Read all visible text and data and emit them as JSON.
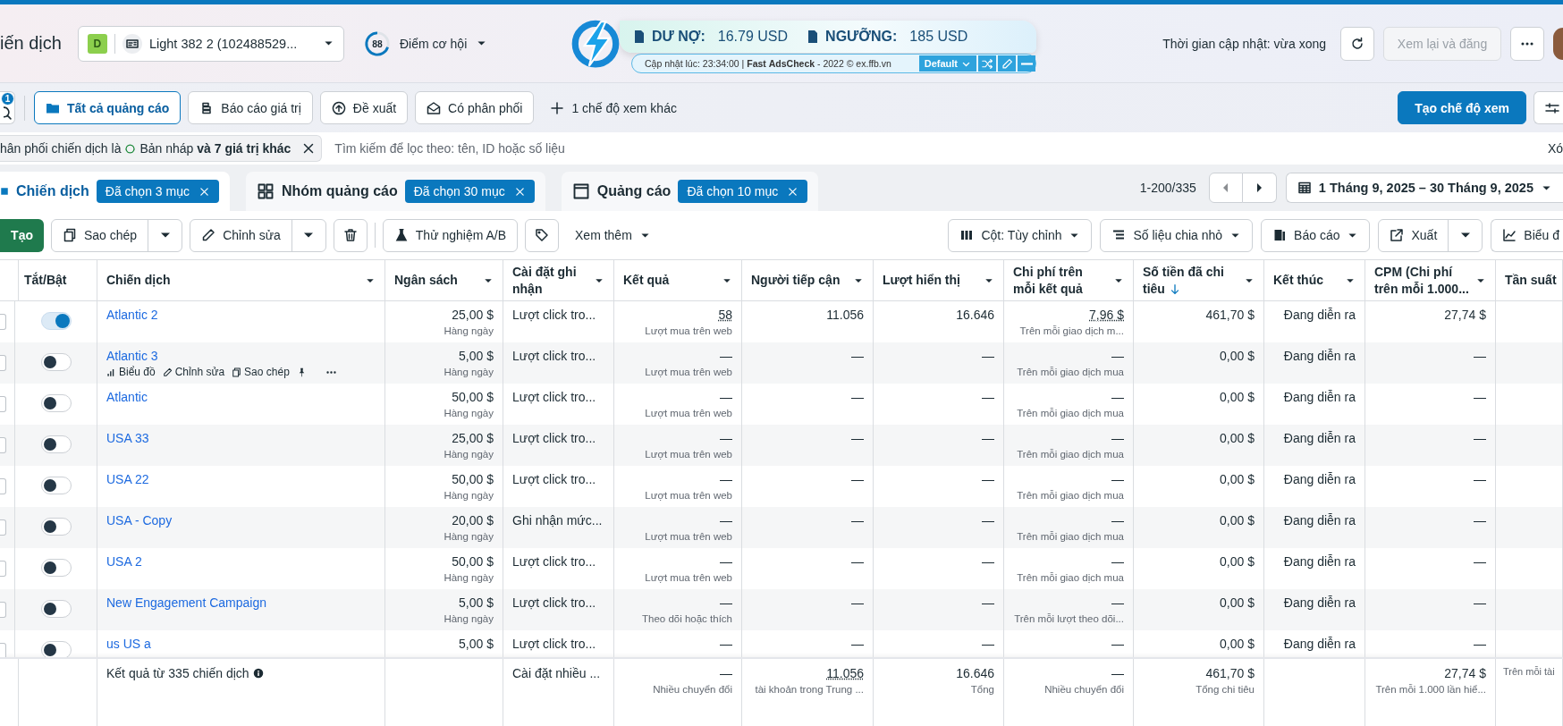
{
  "header": {
    "title": "iến dịch",
    "account": {
      "badge": "D",
      "name": "Light 382 2 (102488529..."
    },
    "score": {
      "value": "88",
      "label": "Điểm cơ hội"
    },
    "update_time": "Thời gian cập nhật: vừa xong",
    "review_button": {
      "label": "Xem lại và đăng",
      "disabled": true
    }
  },
  "extension": {
    "debt_label": "DƯ NỢ:",
    "debt_value": "16.79 USD",
    "threshold_label": "NGƯỠNG:",
    "threshold_value": "185 USD",
    "status": "Cập nhật lúc: 23:34:00 | **Fast** **AdsCheck** - 2022 © ex.ffb.vn",
    "preset": "Default"
  },
  "views": {
    "search_badge": "1",
    "items": [
      {
        "label": "Tất cả quảng cáo",
        "kind": "folder",
        "selected": true
      },
      {
        "label": "Báo cáo giá trị",
        "kind": "coins",
        "selected": false
      },
      {
        "label": "Đề xuất",
        "kind": "upload",
        "selected": false
      },
      {
        "label": "Có phân phối",
        "kind": "mail",
        "selected": false
      }
    ],
    "more": "1 chế độ xem khác",
    "create": "Tạo chế độ xem"
  },
  "filter": {
    "prefix": "hân phối chiến dịch là",
    "value": "Bản nháp **và 7 giá trị khác**",
    "search_placeholder": "Tìm kiếm để lọc theo: tên, ID hoặc số liệu",
    "clear": "Xó"
  },
  "levels": [
    {
      "label": "Chiến dịch",
      "kind": "campaign",
      "badge": "Đã chọn 3 mục",
      "selected": true
    },
    {
      "label": "Nhóm quảng cáo",
      "kind": "adset",
      "badge": "Đã chọn 30 mục",
      "selected": false
    },
    {
      "label": "Quảng cáo",
      "kind": "ad",
      "badge": "Đã chọn 10 mục",
      "selected": false
    }
  ],
  "pagination": "1-200/335",
  "date_range": "1 Tháng 9, 2025 – 30 Tháng 9, 2025",
  "toolbar": {
    "create": "Tạo",
    "duplicate": "Sao chép",
    "edit": "Chỉnh sửa",
    "ab_test": "Thử nghiệm A/B",
    "more": "Xem thêm",
    "columns": "Cột: Tùy chỉnh",
    "breakdown": "Số liệu chia nhỏ",
    "reports": "Báo cáo",
    "export": "Xuất",
    "charts": "Biểu đ"
  },
  "table": {
    "fixed_columns": [
      {
        "label": "Tắt/Bật"
      },
      {
        "label": "Chiến dịch"
      }
    ],
    "columns": [
      {
        "label": "Ngân sách",
        "sorted": false
      },
      {
        "label": "Cài đặt ghi nhận",
        "sorted": false
      },
      {
        "label": "Kết quả",
        "sorted": false
      },
      {
        "label": "Người tiếp cận",
        "sorted": false
      },
      {
        "label": "Lượt hiển thị",
        "sorted": false
      },
      {
        "label": "Chi phí trên mỗi kết quả",
        "sorted": false
      },
      {
        "label": "Số tiền đã chi tiêu",
        "sorted": true
      },
      {
        "label": "Kết thúc",
        "sorted": false
      },
      {
        "label": "CPM (Chi phí trên mỗi 1.000...",
        "sorted": false
      },
      {
        "label": "Tần suất",
        "sorted": false
      }
    ],
    "rows": [
      {
        "name": "Atlantic 2",
        "on": true,
        "checked": false,
        "cells": [
          {
            "value": "25,00 $",
            "sub": "Hàng ngày"
          },
          {
            "value": "Lượt click tro..."
          },
          {
            "value": "58",
            "sub": "Lượt mua trên web",
            "dotted": true
          },
          {
            "value": "11.056"
          },
          {
            "value": "16.646"
          },
          {
            "value": "7,96 $",
            "sub": "Trên mỗi giao dịch m...",
            "dotted": true
          },
          {
            "value": "461,70 $"
          },
          {
            "value": "Đang diễn ra"
          },
          {
            "value": "27,74 $"
          }
        ]
      },
      {
        "name": "Atlantic 3",
        "on": false,
        "checked": false,
        "actions": [
          {
            "kind": "chart",
            "label": "Biểu đồ"
          },
          {
            "kind": "edit",
            "label": "Chỉnh sửa"
          },
          {
            "kind": "copy",
            "label": "Sao chép"
          },
          {
            "kind": "pin"
          },
          {
            "kind": "more"
          }
        ],
        "cells": [
          {
            "value": "5,00 $",
            "sub": "Hàng ngày"
          },
          {
            "value": "Lượt click tro..."
          },
          {
            "value": "—",
            "sub": "Lượt mua trên web"
          },
          {
            "value": "—"
          },
          {
            "value": "—"
          },
          {
            "value": "—",
            "sub": "Trên mỗi giao dịch mua"
          },
          {
            "value": "0,00 $"
          },
          {
            "value": "Đang diễn ra"
          },
          {
            "value": "—"
          }
        ]
      },
      {
        "name": "Atlantic",
        "on": false,
        "checked": false,
        "cells": [
          {
            "value": "50,00 $",
            "sub": "Hàng ngày"
          },
          {
            "value": "Lượt click tro..."
          },
          {
            "value": "—",
            "sub": "Lượt mua trên web"
          },
          {
            "value": "—"
          },
          {
            "value": "—"
          },
          {
            "value": "—",
            "sub": "Trên mỗi giao dịch mua"
          },
          {
            "value": "0,00 $"
          },
          {
            "value": "Đang diễn ra"
          },
          {
            "value": "—"
          }
        ]
      },
      {
        "name": "USA 33",
        "on": false,
        "checked": false,
        "cells": [
          {
            "value": "25,00 $",
            "sub": "Hàng ngày"
          },
          {
            "value": "Lượt click tro..."
          },
          {
            "value": "—",
            "sub": "Lượt mua trên web"
          },
          {
            "value": "—"
          },
          {
            "value": "—"
          },
          {
            "value": "—",
            "sub": "Trên mỗi giao dịch mua"
          },
          {
            "value": "0,00 $"
          },
          {
            "value": "Đang diễn ra"
          },
          {
            "value": "—"
          }
        ]
      },
      {
        "name": "USA 22",
        "on": false,
        "checked": false,
        "cells": [
          {
            "value": "50,00 $",
            "sub": "Hàng ngày"
          },
          {
            "value": "Lượt click tro..."
          },
          {
            "value": "—",
            "sub": "Lượt mua trên web"
          },
          {
            "value": "—"
          },
          {
            "value": "—"
          },
          {
            "value": "—",
            "sub": "Trên mỗi giao dịch mua"
          },
          {
            "value": "0,00 $"
          },
          {
            "value": "Đang diễn ra"
          },
          {
            "value": "—"
          }
        ]
      },
      {
        "name": "USA - Copy",
        "on": false,
        "checked": false,
        "cells": [
          {
            "value": "20,00 $",
            "sub": "Hàng ngày"
          },
          {
            "value": "Ghi nhận mức..."
          },
          {
            "value": "—",
            "sub": "Lượt mua trên web"
          },
          {
            "value": "—"
          },
          {
            "value": "—"
          },
          {
            "value": "—",
            "sub": "Trên mỗi giao dịch mua"
          },
          {
            "value": "0,00 $"
          },
          {
            "value": "Đang diễn ra"
          },
          {
            "value": "—"
          }
        ]
      },
      {
        "name": "USA 2",
        "on": false,
        "checked": false,
        "cells": [
          {
            "value": "50,00 $",
            "sub": "Hàng ngày"
          },
          {
            "value": "Lượt click tro..."
          },
          {
            "value": "—",
            "sub": "Lượt mua trên web"
          },
          {
            "value": "—"
          },
          {
            "value": "—"
          },
          {
            "value": "—",
            "sub": "Trên mỗi giao dịch mua"
          },
          {
            "value": "0,00 $"
          },
          {
            "value": "Đang diễn ra"
          },
          {
            "value": "—"
          }
        ]
      },
      {
        "name": "New Engagement Campaign",
        "on": false,
        "checked": false,
        "cells": [
          {
            "value": "5,00 $",
            "sub": "Hàng ngày"
          },
          {
            "value": "Lượt click tro..."
          },
          {
            "value": "—",
            "sub": "Theo dõi hoặc thích"
          },
          {
            "value": "—"
          },
          {
            "value": "—"
          },
          {
            "value": "—",
            "sub": "Trên mỗi lượt theo dõi..."
          },
          {
            "value": "0,00 $"
          },
          {
            "value": "Đang diễn ra"
          },
          {
            "value": "—"
          }
        ]
      },
      {
        "name": "us US a",
        "on": false,
        "checked": false,
        "cells": [
          {
            "value": "5,00 $"
          },
          {
            "value": "Lượt click tro..."
          },
          {
            "value": "—"
          },
          {
            "value": "—"
          },
          {
            "value": "—"
          },
          {
            "value": "—"
          },
          {
            "value": "0,00 $"
          },
          {
            "value": "Đang diễn ra"
          },
          {
            "value": "—"
          }
        ]
      }
    ],
    "footer": {
      "label": "Kết quả từ 335 chiến dịch",
      "cells": [
        null,
        {
          "value": "Cài đặt nhiều ..."
        },
        {
          "value": "—",
          "sub": "Nhiều chuyển đổi"
        },
        {
          "value": "11.056",
          "sub": "tài khoản trong Trung ...",
          "dotted": true
        },
        {
          "value": "16.646",
          "sub": "Tổng"
        },
        {
          "value": "—",
          "sub": "Nhiều chuyển đổi"
        },
        {
          "value": "461,70 $",
          "sub": "Tổng chi tiêu"
        },
        null,
        {
          "value": "27,74 $",
          "sub": "Trên mỗi 1.000 lần hiể..."
        },
        {
          "sub": "Trên mỗi tài"
        }
      ]
    }
  }
}
